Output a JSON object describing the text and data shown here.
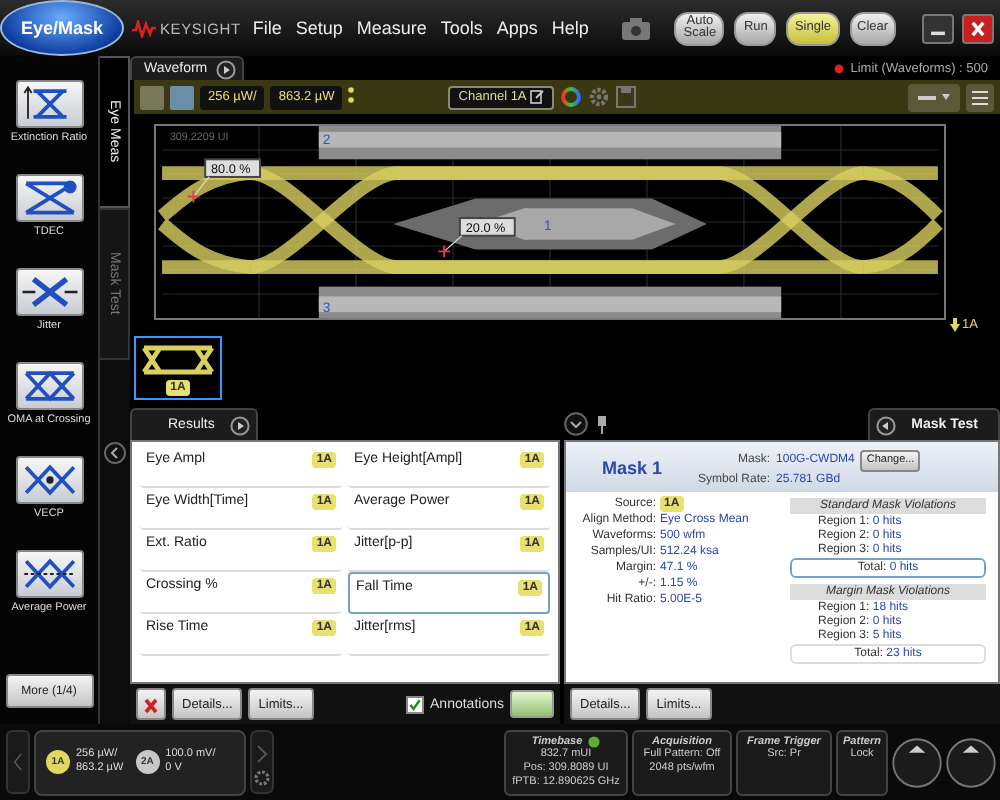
{
  "app_button": {
    "label": "Eye/Mask"
  },
  "brand": {
    "name": "KEYSIGHT"
  },
  "menu": [
    "File",
    "Setup",
    "Measure",
    "Tools",
    "Apps",
    "Help"
  ],
  "controls": [
    {
      "label": "Auto Scale",
      "selected": false
    },
    {
      "label": "Run",
      "selected": false
    },
    {
      "label": "Single",
      "selected": true
    },
    {
      "label": "Clear",
      "selected": false
    }
  ],
  "limit_status": "Limit (Waveforms) : 500",
  "measurements": [
    {
      "label": "Extinction Ratio",
      "kind": "extinction_ratio"
    },
    {
      "label": "TDEC",
      "kind": "tdec"
    },
    {
      "label": "Jitter",
      "kind": "jitter"
    },
    {
      "label": "OMA at Crossing",
      "kind": "oma"
    },
    {
      "label": "VECP",
      "kind": "vecp"
    },
    {
      "label": "Average Power",
      "kind": "average_power"
    }
  ],
  "more_button": "More (1/4)",
  "side_tabs": [
    {
      "label": "Eye Meas",
      "selected": true
    },
    {
      "label": "Mask Test",
      "selected": false
    }
  ],
  "waveform": {
    "tab": "Waveform",
    "scale": "256 µW/",
    "offset": "863.2 µW",
    "channel": "Channel 1A",
    "position": "309.2209 UI",
    "markers": [
      "80.0 %",
      "20.0 %"
    ],
    "regions": [
      "2",
      "1",
      "3"
    ],
    "channel_marker": "1A",
    "thumbnail": "1A"
  },
  "results": {
    "tab": "Results",
    "items": [
      {
        "name": "Eye Ampl",
        "source": "1A",
        "selected": false
      },
      {
        "name": "Eye Height[Ampl]",
        "source": "1A",
        "selected": false
      },
      {
        "name": "Eye Width[Time]",
        "source": "1A",
        "selected": false
      },
      {
        "name": "Average Power",
        "source": "1A",
        "selected": false
      },
      {
        "name": "Ext. Ratio",
        "source": "1A",
        "selected": false
      },
      {
        "name": "Jitter[p-p]",
        "source": "1A",
        "selected": false
      },
      {
        "name": "Crossing %",
        "source": "1A",
        "selected": false
      },
      {
        "name": "Fall Time",
        "source": "1A",
        "selected": true
      },
      {
        "name": "Rise Time",
        "source": "1A",
        "selected": false
      },
      {
        "name": "Jitter[rms]",
        "source": "1A",
        "selected": false
      }
    ],
    "buttons": [
      "Details...",
      "Limits..."
    ],
    "annotations": {
      "label": "Annotations",
      "checked": true
    }
  },
  "mask_test": {
    "tab": "Mask Test",
    "title": "Mask 1",
    "mask_label": "Mask:",
    "mask": "100G-CWDM4",
    "change": "Change...",
    "symbol_rate_label": "Symbol Rate:",
    "symbol_rate": "25.781 GBd",
    "fields": [
      {
        "label": "Source:",
        "value": "1A",
        "kind": "badge"
      },
      {
        "label": "Align Method:",
        "value": "Eye Cross Mean",
        "kind": "text"
      },
      {
        "label": "Waveforms:",
        "value": "500 wfm",
        "kind": "text"
      },
      {
        "label": "Samples/UI:",
        "value": "512.24 ksa",
        "kind": "text"
      },
      {
        "label": "Margin:",
        "value": "47.1 %",
        "kind": "text"
      },
      {
        "label": "+/-:",
        "value": "1.15 %",
        "kind": "text"
      },
      {
        "label": "Hit Ratio:",
        "value": "5.00E-5",
        "kind": "text"
      }
    ],
    "violations": [
      {
        "title": "Standard Mask Violations",
        "regions": [
          {
            "label": "Region 1:",
            "value": "0 hits"
          },
          {
            "label": "Region 2:",
            "value": "0 hits"
          },
          {
            "label": "Region 3:",
            "value": "0 hits"
          }
        ],
        "total": {
          "label": "Total:",
          "value": "0 hits",
          "selected": true
        }
      },
      {
        "title": "Margin Mask Violations",
        "regions": [
          {
            "label": "Region 1:",
            "value": "18 hits"
          },
          {
            "label": "Region 2:",
            "value": "0 hits"
          },
          {
            "label": "Region 3:",
            "value": "5 hits"
          }
        ],
        "total": {
          "label": "Total:",
          "value": "23 hits",
          "selected": false
        }
      }
    ],
    "buttons": [
      "Details...",
      "Limits..."
    ]
  },
  "status": {
    "channels": [
      {
        "label": "1A",
        "lines": [
          "256 µW/",
          "863.2 µW"
        ],
        "color": "#e0d860"
      },
      {
        "label": "2A",
        "lines": [
          "100.0 mV/",
          "0 V"
        ],
        "color": "#c8c8c8"
      }
    ],
    "panels": [
      {
        "title": "Timebase",
        "lines": [
          "832.7 mUI",
          "Pos: 309.8089 UI",
          "fPTB: 12.890625 GHz"
        ],
        "indicator": true
      },
      {
        "title": "Acquisition",
        "lines": [
          "Full Pattern: Off",
          "2048 pts/wfm"
        ],
        "indicator": false
      },
      {
        "title": "Frame Trigger",
        "lines": [
          "Src: Pr"
        ],
        "indicator": false
      },
      {
        "title": "Pattern",
        "lines": [
          "Lock"
        ],
        "indicator": false
      }
    ]
  }
}
